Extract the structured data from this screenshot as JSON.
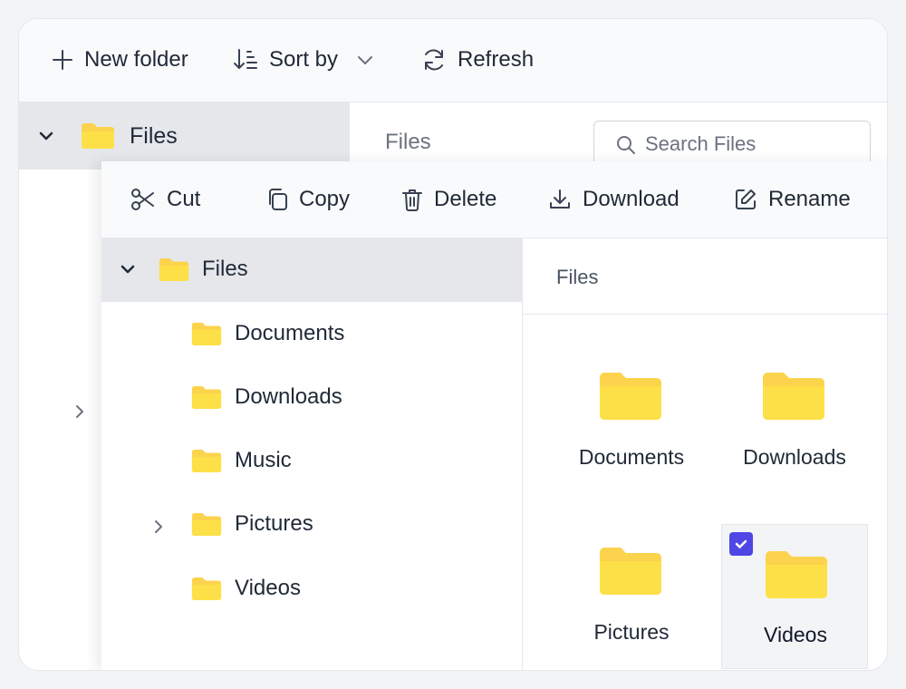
{
  "back_toolbar": {
    "new_folder_label": "New folder",
    "sort_by_label": "Sort by",
    "refresh_label": "Refresh"
  },
  "back_tree": {
    "root_label": "Files"
  },
  "back_breadcrumb": "Files",
  "search": {
    "placeholder": "Search Files"
  },
  "front_toolbar": {
    "cut_label": "Cut",
    "copy_label": "Copy",
    "delete_label": "Delete",
    "download_label": "Download",
    "rename_label": "Rename"
  },
  "tree": {
    "root_label": "Files",
    "items": [
      {
        "label": "Documents"
      },
      {
        "label": "Downloads"
      },
      {
        "label": "Music"
      },
      {
        "label": "Pictures"
      },
      {
        "label": "Videos"
      }
    ]
  },
  "content": {
    "breadcrumb": "Files",
    "tiles": [
      {
        "label": "Documents",
        "selected": false
      },
      {
        "label": "Downloads",
        "selected": false
      },
      {
        "label": "Pictures",
        "selected": false
      },
      {
        "label": "Videos",
        "selected": true
      }
    ]
  },
  "colors": {
    "folder": "#fcd34d",
    "folder_front": "#fde047",
    "accent": "#4f46e5"
  }
}
